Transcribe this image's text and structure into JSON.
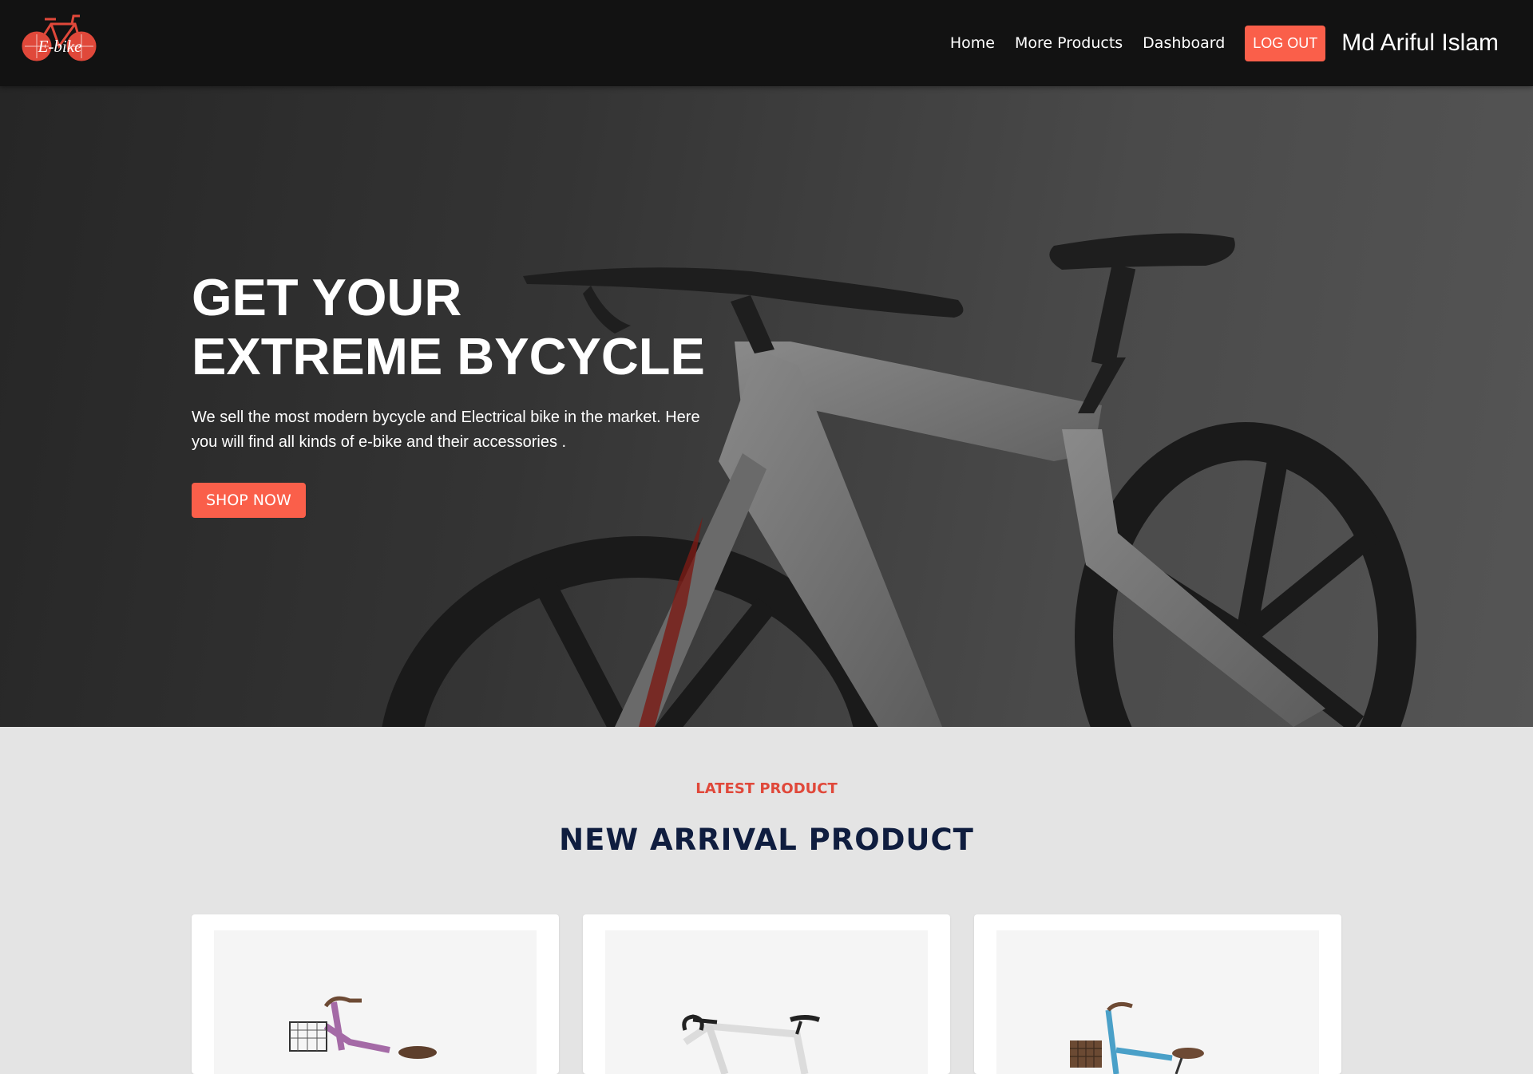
{
  "nav": {
    "logo_text": "E-bike",
    "links": [
      "Home",
      "More Products",
      "Dashboard"
    ],
    "logout_label": "LOG OUT",
    "user_name": "Md Ariful Islam"
  },
  "hero": {
    "title_line1": "GET YOUR",
    "title_line2": "EXTREME BYCYCLE",
    "description": "We sell the most modern bycycle and Electrical bike in the market. Here you will find all kinds of e-bike and their accessories .",
    "cta_label": "SHOP NOW"
  },
  "products": {
    "kicker": "LATEST PRODUCT",
    "title": "NEW ARRIVAL PRODUCT",
    "cards": [
      {
        "image": "purple-bike-with-basket"
      },
      {
        "image": "white-road-bike"
      },
      {
        "image": "blue-bike-with-basket"
      }
    ]
  },
  "colors": {
    "accent": "#fa5f4a",
    "nav_bg": "#121212",
    "section_title": "#0f1d3f",
    "kicker": "#e0483a"
  }
}
